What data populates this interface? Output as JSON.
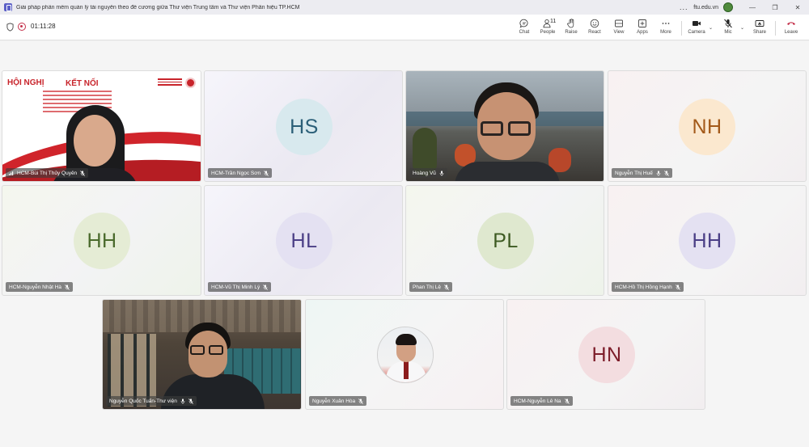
{
  "window": {
    "title": "Giải pháp phần mềm quản lý tài nguyên theo đề cương giữa Thư viện Trung tâm và Thư viện Phân hiệu TP.HCM",
    "more_label": "...",
    "org": "ftu.edu.vn",
    "minimize": "—",
    "maximize": "❐",
    "close": "✕"
  },
  "toolbar": {
    "timer": "01:11:28",
    "people_count": "11",
    "buttons": {
      "chat": "Chat",
      "people": "People",
      "raise": "Raise",
      "react": "React",
      "view": "View",
      "apps": "Apps",
      "more": "More",
      "camera": "Camera",
      "mic": "Mic",
      "share": "Share",
      "leave": "Leave"
    },
    "caret": "⌄"
  },
  "slide": {
    "title_left": "HỘI NGHỊ",
    "title_right": "KẾT NỐI"
  },
  "participants": [
    {
      "name": "HCM-Bùi Thị Thủy Quyên"
    },
    {
      "name": "HCM-Trần Ngọc Sơn",
      "initials": "HS",
      "color": "#2b5f78",
      "circle": "#d8e9ee"
    },
    {
      "name": "Hoàng Vũ"
    },
    {
      "name": "Nguyễn Thị Huế",
      "initials": "NH",
      "color": "#a35a1a",
      "circle": "#fbe8cf"
    },
    {
      "name": "HCM-Nguyễn Nhật Hà",
      "initials": "HH",
      "color": "#4a6a2c",
      "circle": "#e5ecd5"
    },
    {
      "name": "HCM-Vũ Thị Minh Lý",
      "initials": "HL",
      "color": "#4b3f86",
      "circle": "#e4e1f2"
    },
    {
      "name": "Phan Thị Lệ",
      "initials": "PL",
      "color": "#3d5a22",
      "circle": "#dfe8cf"
    },
    {
      "name": "HCM-Hồ Thị Hồng Hạnh",
      "initials": "HH",
      "color": "#4b3f86",
      "circle": "#e4e1f2"
    },
    {
      "name": "Nguyễn Quốc Tuấn-Thư viện"
    },
    {
      "name": "Nguyễn Xuân Hòa"
    },
    {
      "name": "HCM-Nguyễn Lê Na",
      "initials": "HN",
      "color": "#7d1d2a",
      "circle": "#f3dde0"
    }
  ]
}
